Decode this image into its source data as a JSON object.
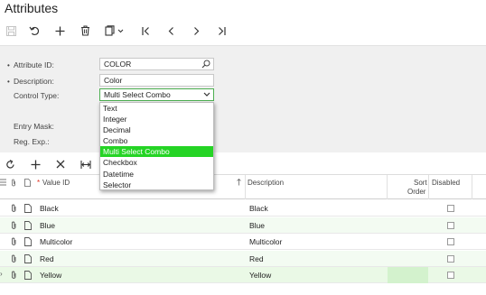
{
  "page": {
    "title": "Attributes"
  },
  "toolbar": {
    "buttons": [
      {
        "icon": "save-icon",
        "enabled": false
      },
      {
        "icon": "undo-icon",
        "enabled": true
      },
      {
        "icon": "add-icon",
        "enabled": true
      },
      {
        "icon": "delete-icon",
        "enabled": true
      },
      {
        "icon": "copy-paste-icon",
        "enabled": true
      },
      {
        "icon": "first-record-icon",
        "enabled": true
      },
      {
        "icon": "previous-record-icon",
        "enabled": true
      },
      {
        "icon": "next-record-icon",
        "enabled": true
      },
      {
        "icon": "last-record-icon",
        "enabled": true
      }
    ]
  },
  "form": {
    "attribute_id": {
      "label": "Attribute ID:",
      "value": "COLOR",
      "required": true
    },
    "description": {
      "label": "Description:",
      "value": "Color",
      "required": true
    },
    "control_type": {
      "label": "Control Type:",
      "value": "Multi Select Combo"
    },
    "entry_mask": {
      "label": "Entry Mask:"
    },
    "reg_exp": {
      "label": "Reg. Exp.:"
    }
  },
  "control_type_options": [
    "Text",
    "Integer",
    "Decimal",
    "Combo",
    "Multi Select Combo",
    "Checkbox",
    "Datetime",
    "Selector"
  ],
  "control_type_selected_index": 4,
  "grid": {
    "toolbar": [
      {
        "icon": "refresh-icon"
      },
      {
        "icon": "add-row-icon"
      },
      {
        "icon": "delete-row-icon"
      },
      {
        "icon": "fit-columns-icon"
      }
    ],
    "headers": {
      "value_id": "Value ID",
      "description": "Description",
      "sort_order_1": "Sort",
      "sort_order_2": "Order",
      "disabled": "Disabled"
    },
    "rows": [
      {
        "value_id": "Black",
        "description": "Black",
        "disabled": false
      },
      {
        "value_id": "Blue",
        "description": "Blue",
        "disabled": false
      },
      {
        "value_id": "Multicolor",
        "description": "Multicolor",
        "disabled": false
      },
      {
        "value_id": "Red",
        "description": "Red",
        "disabled": false
      },
      {
        "value_id": "Yellow",
        "description": "Yellow",
        "disabled": false
      }
    ],
    "active_row_index": 4,
    "active_row_marker": "›"
  },
  "colors": {
    "accent_green": "#25d425",
    "focus_border": "#4caf50"
  }
}
